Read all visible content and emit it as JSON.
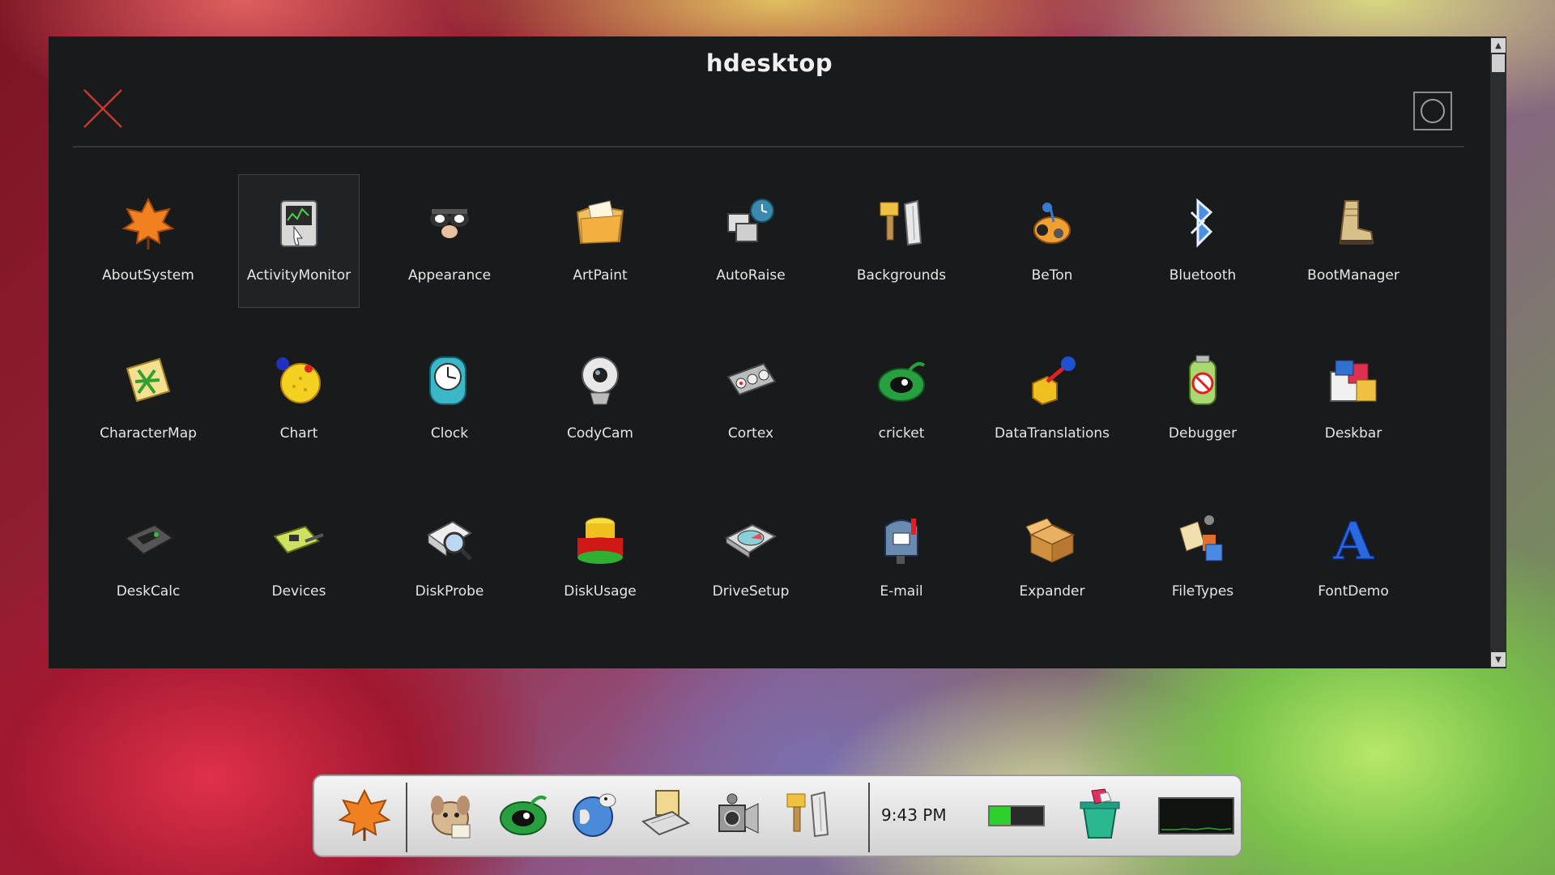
{
  "window": {
    "title": "hdesktop",
    "close_icon": "close-x-icon",
    "toggle_icon": "circle-toggle-icon"
  },
  "apps": [
    {
      "label": "AboutSystem",
      "icon": "leaf-icon",
      "selected": false
    },
    {
      "label": "ActivityMonitor",
      "icon": "activity-monitor-icon",
      "selected": true
    },
    {
      "label": "Appearance",
      "icon": "appearance-icon",
      "selected": false
    },
    {
      "label": "ArtPaint",
      "icon": "artpaint-folder-icon",
      "selected": false
    },
    {
      "label": "AutoRaise",
      "icon": "autoraise-icon",
      "selected": false
    },
    {
      "label": "Backgrounds",
      "icon": "backgrounds-brush-icon",
      "selected": false
    },
    {
      "label": "BeTon",
      "icon": "beton-icon",
      "selected": false
    },
    {
      "label": "Bluetooth",
      "icon": "bluetooth-icon",
      "selected": false
    },
    {
      "label": "BootManager",
      "icon": "boot-icon",
      "selected": false
    },
    {
      "label": "CharacterMap",
      "icon": "charactermap-icon",
      "selected": false
    },
    {
      "label": "Chart",
      "icon": "chart-stars-icon",
      "selected": false
    },
    {
      "label": "Clock",
      "icon": "clock-icon",
      "selected": false
    },
    {
      "label": "CodyCam",
      "icon": "webcam-icon",
      "selected": false
    },
    {
      "label": "Cortex",
      "icon": "cortex-icon",
      "selected": false
    },
    {
      "label": "cricket",
      "icon": "cricket-icon",
      "selected": false
    },
    {
      "label": "DataTranslations",
      "icon": "datatranslations-icon",
      "selected": false
    },
    {
      "label": "Debugger",
      "icon": "debugger-bug-icon",
      "selected": false
    },
    {
      "label": "Deskbar",
      "icon": "deskbar-icon",
      "selected": false
    },
    {
      "label": "DeskCalc",
      "icon": "calculator-icon",
      "selected": false
    },
    {
      "label": "Devices",
      "icon": "devices-card-icon",
      "selected": false
    },
    {
      "label": "DiskProbe",
      "icon": "diskprobe-icon",
      "selected": false
    },
    {
      "label": "DiskUsage",
      "icon": "diskusage-icon",
      "selected": false
    },
    {
      "label": "DriveSetup",
      "icon": "drivesetup-icon",
      "selected": false
    },
    {
      "label": "E-mail",
      "icon": "mailbox-icon",
      "selected": false
    },
    {
      "label": "Expander",
      "icon": "box-icon",
      "selected": false
    },
    {
      "label": "FileTypes",
      "icon": "filetypes-icon",
      "selected": false
    },
    {
      "label": "FontDemo",
      "icon": "font-letter-a-icon",
      "selected": false
    }
  ],
  "deskbar": {
    "items": [
      {
        "icon": "leaf-icon"
      },
      {
        "icon": "tracker-dog-icon"
      },
      {
        "icon": "cricket-icon"
      },
      {
        "icon": "webpositive-globe-icon"
      },
      {
        "icon": "computer-icon"
      },
      {
        "icon": "camera-icon"
      },
      {
        "icon": "backgrounds-brush-icon"
      }
    ],
    "time": "9:43 PM",
    "battery_level": 0.4,
    "trash_icon": "trash-icon",
    "monitor_icon": "process-monitor-icon"
  }
}
